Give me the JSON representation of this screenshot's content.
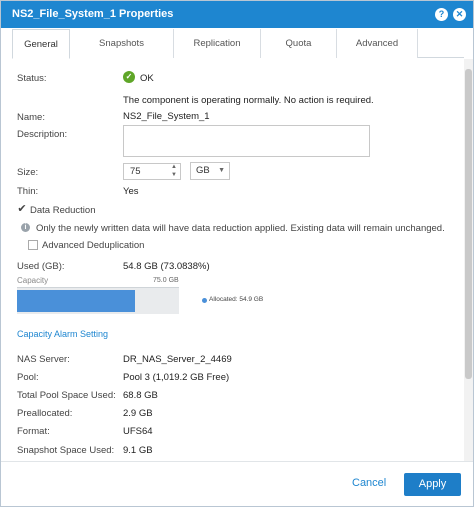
{
  "window": {
    "title": "NS2_File_System_1 Properties",
    "help_glyph": "?",
    "close_glyph": "✕"
  },
  "tabs": [
    {
      "label": "General",
      "active": true
    },
    {
      "label": "Snapshots",
      "active": false
    },
    {
      "label": "Replication",
      "active": false
    },
    {
      "label": "Quota",
      "active": false
    },
    {
      "label": "Advanced",
      "active": false
    }
  ],
  "general": {
    "status_label": "Status:",
    "status_value": "OK",
    "status_icon_glyph": "✓",
    "status_message": "The component is operating normally. No action is required.",
    "name_label": "Name:",
    "name_value": "NS2_File_System_1",
    "description_label": "Description:",
    "description_value": "",
    "size_label": "Size:",
    "size_value": "75",
    "size_unit": "GB",
    "thin_label": "Thin:",
    "thin_value": "Yes",
    "data_reduction_label": "Data Reduction",
    "data_reduction_checked": true,
    "data_reduction_note": "Only the newly written data will have data reduction applied. Existing data will remain unchanged.",
    "advanced_dedup_label": "Advanced Deduplication",
    "advanced_dedup_checked": false,
    "used_label": "Used (GB):",
    "used_value": "54.8 GB (73.0838%)",
    "capacity_label": "Capacity",
    "capacity_total": "75.0 GB",
    "capacity_allocated_legend": "Allocated: 54.9 GB",
    "capacity_fraction": 0.73,
    "alarm_link": "Capacity Alarm Setting",
    "nas_server_label": "NAS Server:",
    "nas_server_value": "DR_NAS_Server_2_4469",
    "pool_label": "Pool:",
    "pool_value": "Pool 3 (1,019.2 GB Free)",
    "total_pool_label": "Total Pool Space Used:",
    "total_pool_value": "68.8 GB",
    "preallocated_label": "Preallocated:",
    "preallocated_value": "2.9 GB",
    "format_label": "Format:",
    "format_value": "UFS64",
    "snapshot_label": "Snapshot Space Used:",
    "snapshot_value": "9.1 GB"
  },
  "footer": {
    "cancel_label": "Cancel",
    "apply_label": "Apply"
  },
  "colors": {
    "accent": "#1e86d0",
    "ok_green": "#5fa628",
    "bar_fill": "#4a90d9"
  }
}
